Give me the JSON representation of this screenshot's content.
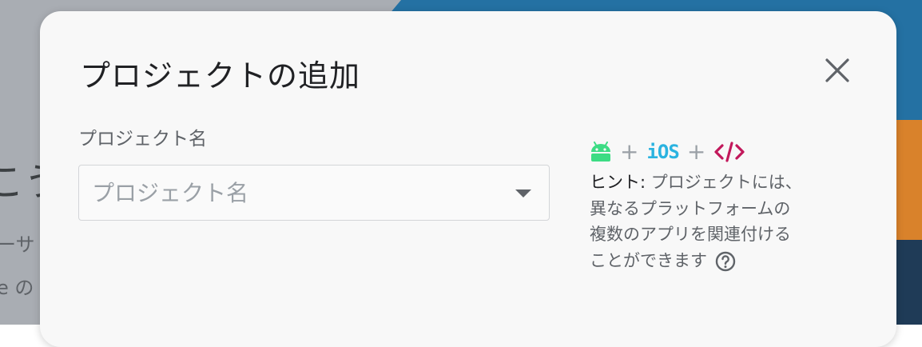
{
  "background": {
    "heading_fragment": "こう",
    "line1_fragment": "ーサ",
    "line2_fragment": "e の"
  },
  "dialog": {
    "title": "プロジェクトの追加",
    "close_icon": "close-icon",
    "project_name": {
      "label": "プロジェクト名",
      "placeholder": "プロジェクト名",
      "value": ""
    },
    "platforms": {
      "android_icon": "android-icon",
      "plus": "+",
      "ios_label": "iOS",
      "web_icon": "code-icon"
    },
    "hint": {
      "label": "ヒント:",
      "line1": "プロジェクトには、",
      "line2": "異なるプラットフォームの",
      "line3": "複数のアプリを関連付ける",
      "line4": "ことができます"
    },
    "help_icon": "help-circle-icon"
  },
  "colors": {
    "android": "#3ddc84",
    "ios": "#2bb3e0",
    "web": "#c2185b",
    "dialog_bg": "#f8f8f8",
    "background_blue": "#2471a3"
  }
}
